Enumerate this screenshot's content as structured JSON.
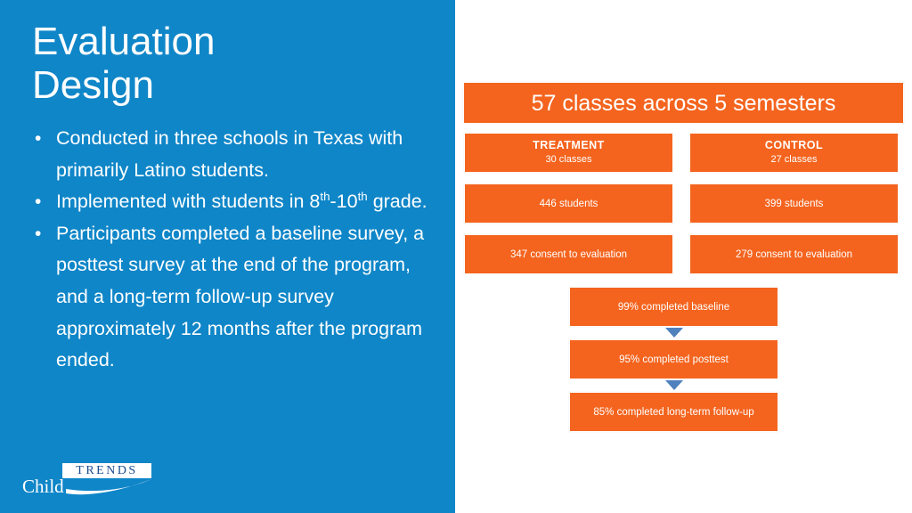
{
  "slide": {
    "title_line1": "Evaluation",
    "title_line2": "Design",
    "bullets": [
      "Conducted in three schools in Texas with primarily Latino students.",
      "Implemented with students in 8th-10th grade.",
      "Participants completed a baseline survey, a posttest survey at the end of the program, and a long-term follow-up survey approximately 12 months after the program ended."
    ],
    "bullet_marker": "•"
  },
  "logo": {
    "word_child": "Child",
    "word_trends": "TRENDS"
  },
  "diagram": {
    "header": "57 classes across 5 semesters",
    "treatment": {
      "title": "TREATMENT",
      "classes": "30 classes",
      "students": "446 students",
      "consent": "347 consent to evaluation"
    },
    "control": {
      "title": "CONTROL",
      "classes": "27 classes",
      "students": "399 students",
      "consent": "279 consent to evaluation"
    },
    "outcomes": [
      "99% completed baseline",
      "95% completed posttest",
      "85% completed long-term follow-up"
    ]
  },
  "colors": {
    "panel_blue": "#0f86c8",
    "box_orange": "#f4641e",
    "arrow_blue": "#4f81bd"
  }
}
